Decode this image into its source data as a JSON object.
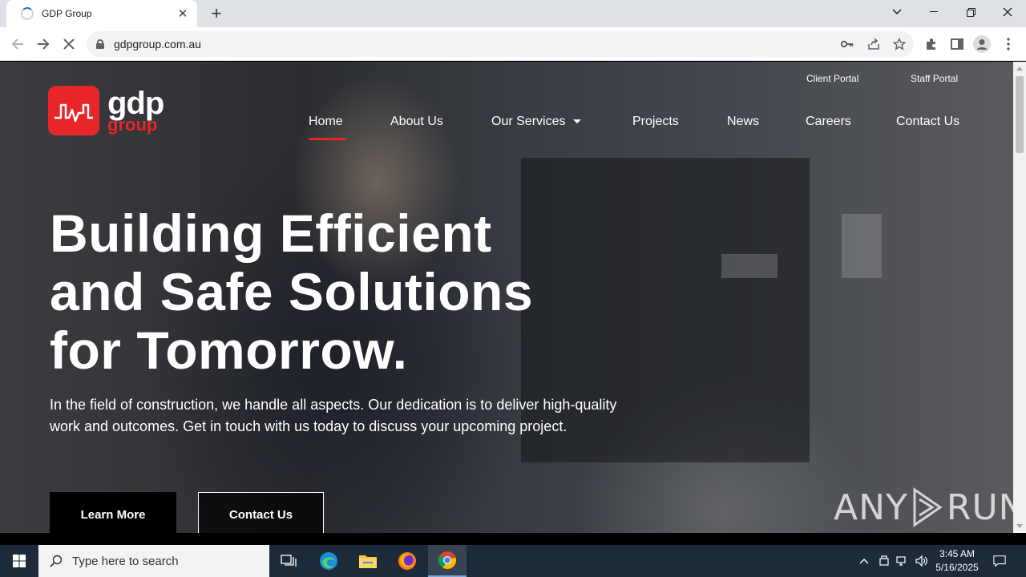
{
  "browser": {
    "tab_title": "GDP Group",
    "url": "gdpgroup.com.au"
  },
  "site": {
    "logo_primary": "gdp",
    "logo_secondary": "group",
    "top_links": [
      "Client Portal",
      "Staff Portal"
    ],
    "nav": [
      "Home",
      "About Us",
      "Our Services",
      "Projects",
      "News",
      "Careers",
      "Contact Us"
    ],
    "active_nav": "Home",
    "hero": {
      "line1": "Building Efficient",
      "line2": "and Safe Solutions",
      "line3": "for Tomorrow.",
      "description": "In the field of construction, we handle all aspects. Our dedication is to deliver high-quality work and outcomes. Get in touch with us today to discuss your upcoming project.",
      "primary_button": "Learn More",
      "secondary_button": "Contact Us"
    },
    "accent_color": "#e8262a"
  },
  "watermark": {
    "left": "ANY",
    "right": "RUN"
  },
  "taskbar": {
    "search_placeholder": "Type here to search",
    "time": "3:45 AM",
    "date": "5/16/2025"
  }
}
